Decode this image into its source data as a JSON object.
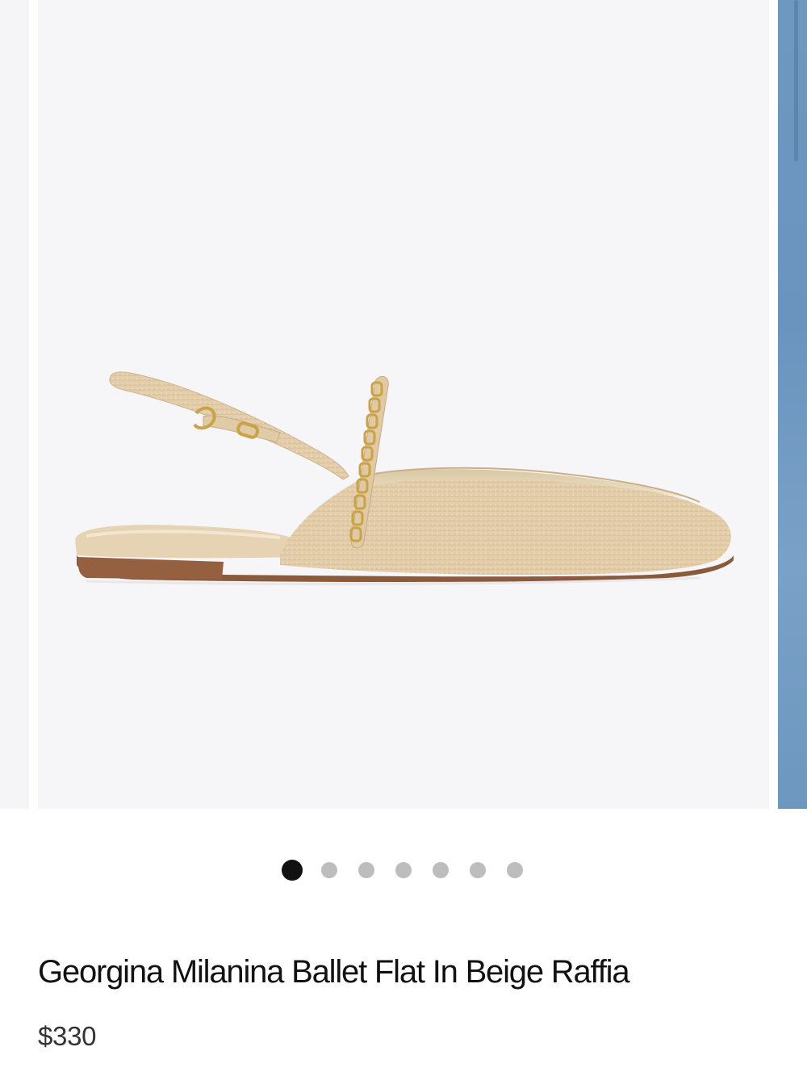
{
  "product": {
    "title": "Georgina Milanina Ballet Flat In Beige Raffia",
    "price": "$330"
  },
  "carousel": {
    "slide_count": 7,
    "active_index": 0
  },
  "colors": {
    "active_dot": "#111111",
    "inactive_dot": "#bdbdbd",
    "image_background": "#f6f5f7",
    "raffia": "#e2ccaa",
    "gold_hardware": "#c9a347",
    "sole": "#8a5a3c"
  }
}
